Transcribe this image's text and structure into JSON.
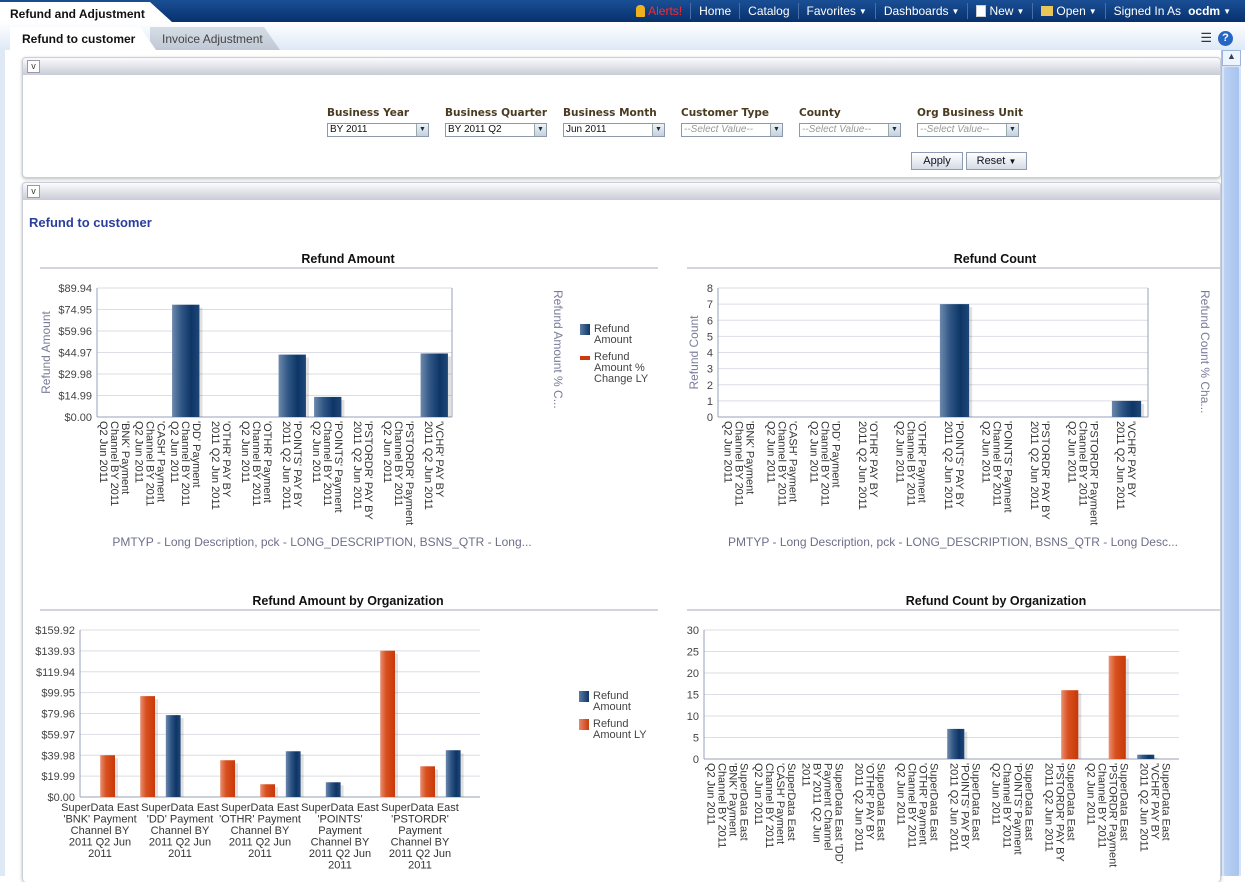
{
  "header": {
    "app_title": "Refund and Adjustment",
    "alerts": "Alerts!",
    "home": "Home",
    "catalog": "Catalog",
    "favorites": "Favorites",
    "dashboards": "Dashboards",
    "new": "New",
    "open": "Open",
    "signed_in_as": "Signed In As",
    "user": "ocdm"
  },
  "tabs": [
    {
      "label": "Refund to customer",
      "active": true
    },
    {
      "label": "Invoice Adjustment",
      "active": false
    }
  ],
  "filters": [
    {
      "label": "Business Year",
      "value": "BY 2011"
    },
    {
      "label": "Business Quarter",
      "value": "BY 2011 Q2"
    },
    {
      "label": "Business Month",
      "value": "Jun 2011"
    },
    {
      "label": "Customer Type",
      "placeholder": "--Select Value--"
    },
    {
      "label": "County",
      "placeholder": "--Select Value--"
    },
    {
      "label": "Org Business Unit",
      "placeholder": "--Select Value--"
    }
  ],
  "buttons": {
    "apply": "Apply",
    "reset": "Reset"
  },
  "section_title": "Refund to customer",
  "colors": {
    "refund_amount": "#1f4a7a",
    "refund_ly": "#d2461a",
    "header": "#0c3c80"
  },
  "chart_data": [
    {
      "type": "bar",
      "title": "Refund Amount",
      "ylabel": "Refund Amount",
      "y2label": "Refund Amount % C...",
      "ylim": [
        0,
        89.94
      ],
      "y_ticks": [
        "$0.00",
        "$14.99",
        "$29.98",
        "$44.97",
        "$59.96",
        "$74.95",
        "$89.94"
      ],
      "xlabel": "PMTYP - Long Description, pck - LONG_DESCRIPTION, BSNS_QTR - Long...",
      "legend": [
        "Refund Amount",
        "Refund Amount % Change LY"
      ],
      "categories": [
        [
          "'BNK' Payment",
          "Channel BY 2011",
          "Q2 Jun 2011"
        ],
        [
          "'CASH' Payment",
          "Channel BY 2011",
          "Q2 Jun 2011"
        ],
        [
          "'DD' Payment",
          "Channel BY 2011",
          "Q2 Jun 2011"
        ],
        [
          "'OTHR' PAY BY",
          "2011 Q2 Jun 2011"
        ],
        [
          "'OTHR' Payment",
          "Channel BY 2011",
          "Q2 Jun 2011"
        ],
        [
          "'POINTS' PAY BY",
          "2011 Q2 Jun 2011"
        ],
        [
          "'POINTS' Payment",
          "Channel BY 2011",
          "Q2 Jun 2011"
        ],
        [
          "'PSTORDR' PAY BY",
          "2011 Q2 Jun 2011"
        ],
        [
          "'PSTORDR' Payment",
          "Channel BY 2011",
          "Q2 Jun 2011"
        ],
        [
          "'VCHR' PAY BY",
          "2011 Q2 Jun 2011"
        ]
      ],
      "series": [
        {
          "name": "Refund Amount",
          "color": "blue",
          "values": [
            null,
            null,
            78.3,
            null,
            null,
            43.5,
            14.0,
            null,
            null,
            44.3
          ]
        }
      ]
    },
    {
      "type": "bar",
      "title": "Refund Count",
      "ylabel": "Refund Count",
      "y2label": "Refund Count % Cha...",
      "ylim": [
        0,
        8
      ],
      "y_ticks": [
        "0",
        "1",
        "2",
        "3",
        "4",
        "5",
        "6",
        "7",
        "8"
      ],
      "xlabel": "PMTYP - Long Description, pck - LONG_DESCRIPTION, BSNS_QTR - Long Desc...",
      "categories": [
        [
          "'BNK' Payment",
          "Channel BY 2011",
          "Q2 Jun 2011"
        ],
        [
          "'CASH' Payment",
          "Channel BY 2011",
          "Q2 Jun 2011"
        ],
        [
          "'DD' Payment",
          "Channel BY 2011",
          "Q2 Jun 2011"
        ],
        [
          "'OTHR' PAY BY",
          "2011 Q2 Jun 2011"
        ],
        [
          "'OTHR' Payment",
          "Channel BY 2011",
          "Q2 Jun 2011"
        ],
        [
          "'POINTS' PAY BY",
          "2011 Q2 Jun 2011"
        ],
        [
          "'POINTS' Payment",
          "Channel BY 2011",
          "Q2 Jun 2011"
        ],
        [
          "'PSTORDR' PAY BY",
          "2011 Q2 Jun 2011"
        ],
        [
          "'PSTORDR' Payment",
          "Channel BY 2011",
          "Q2 Jun 2011"
        ],
        [
          "'VCHR' PAY BY",
          "2011 Q2 Jun 2011"
        ]
      ],
      "series": [
        {
          "color": "blue",
          "values": [
            null,
            null,
            null,
            null,
            null,
            7,
            null,
            null,
            null,
            1
          ]
        }
      ]
    },
    {
      "type": "bar",
      "title": "Refund Amount by Organization",
      "ylim": [
        0,
        159.92
      ],
      "y_ticks": [
        "$0.00",
        "$19.99",
        "$39.98",
        "$59.97",
        "$79.96",
        "$99.95",
        "$119.94",
        "$139.93",
        "$159.92"
      ],
      "legend": [
        "Refund Amount",
        "Refund Amount LY"
      ],
      "categories": [
        [
          "SuperData East",
          "'BNK' Payment",
          "Channel BY",
          "2011 Q2 Jun",
          "2011"
        ],
        null,
        [
          "SuperData East",
          "'DD' Payment",
          "Channel BY",
          "2011 Q2 Jun",
          "2011"
        ],
        null,
        [
          "SuperData East",
          "'OTHR' Payment",
          "Channel BY",
          "2011 Q2 Jun",
          "2011"
        ],
        null,
        [
          "SuperData East",
          "'POINTS'",
          "Payment",
          "Channel BY",
          "2011 Q2 Jun",
          "2011"
        ],
        null,
        [
          "SuperData East",
          "'PSTORDR'",
          "Payment",
          "Channel BY",
          "2011 Q2 Jun",
          "2011"
        ],
        null
      ],
      "series": [
        {
          "name": "Refund Amount",
          "color": "blue",
          "values": [
            null,
            null,
            78.4,
            null,
            null,
            43.8,
            14.1,
            null,
            null,
            44.8
          ]
        },
        {
          "name": "Refund Amount LY",
          "color": "red",
          "values": [
            40.0,
            96.6,
            null,
            35.2,
            12.2,
            null,
            null,
            140.1,
            29.4,
            null
          ]
        }
      ]
    },
    {
      "type": "bar",
      "title": "Refund Count by Organization",
      "ylim": [
        0,
        30
      ],
      "y_ticks": [
        "0",
        "5",
        "10",
        "15",
        "20",
        "25",
        "30"
      ],
      "categories": [
        [
          "SuperData East",
          "'BNK' Payment",
          "Channel BY 2011",
          "Q2 Jun 2011"
        ],
        [
          "SuperData East",
          "'CASH' Payment",
          "Channel BY 2011",
          "Q2 Jun 2011"
        ],
        [
          "SuperData East 'DD'",
          "Payment Channel",
          "BY 2011 Q2 Jun",
          "2011"
        ],
        [
          "SuperData East",
          "'OTHR' PAY BY",
          "2011 Q2 Jun 2011"
        ],
        [
          "SuperData East",
          "'OTHR' Payment",
          "Channel BY 2011",
          "Q2 Jun 2011"
        ],
        [
          "SuperData East",
          "'POINTS' PAY BY",
          "2011 Q2 Jun 2011"
        ],
        [
          "SuperData East",
          "'POINTS' Payment",
          "Channel BY 2011",
          "Q2 Jun 2011"
        ],
        [
          "SuperData East",
          "'PSTORDR' PAY BY",
          "2011 Q2 Jun 2011"
        ],
        [
          "SuperData East",
          "'PSTORDR' Payment",
          "Channel BY 2011",
          "Q2 Jun 2011"
        ],
        [
          "SuperData East",
          "'VCHR' PAY BY",
          "2011 Q2 Jun 2011"
        ]
      ],
      "series": [
        {
          "color": "blue",
          "values": [
            null,
            null,
            null,
            null,
            null,
            7,
            null,
            null,
            null,
            1
          ]
        },
        {
          "color": "red",
          "values": [
            null,
            null,
            null,
            null,
            null,
            null,
            null,
            16,
            24,
            null
          ]
        }
      ]
    }
  ]
}
